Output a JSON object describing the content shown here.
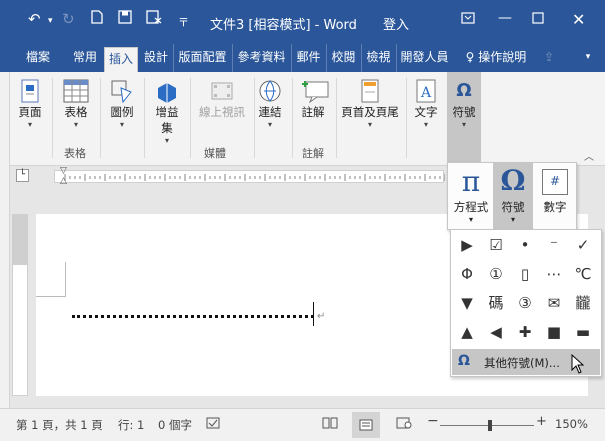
{
  "titlebar": {
    "title": "文件3 [相容模式] - Word",
    "signin": "登入",
    "qa_icons": [
      "undo-icon",
      "redo-icon",
      "new-document-icon",
      "save-icon",
      "save-as-icon",
      "customize-quick-access-icon"
    ],
    "window_controls": [
      "ribbon-display-icon",
      "minimize-icon",
      "maximize-icon",
      "close-icon"
    ]
  },
  "tabs": {
    "items": [
      {
        "label": "檔案"
      },
      {
        "label": "常用"
      },
      {
        "label": "插入"
      },
      {
        "label": "設計"
      },
      {
        "label": "版面配置"
      },
      {
        "label": "參考資料"
      },
      {
        "label": "郵件"
      },
      {
        "label": "校閱"
      },
      {
        "label": "檢視"
      },
      {
        "label": "開發人員"
      }
    ],
    "tell_me": "操作說明",
    "active": "插入"
  },
  "ribbon": {
    "pages_label": "頁面",
    "table_label": "表格",
    "table_group": "表格",
    "illustrations_label": "圖例",
    "addins_label": "增益集",
    "online_video_label": "線上視訊",
    "media_group": "媒體",
    "links_label": "連結",
    "comment_label": "註解",
    "comment_group": "註解",
    "header_footer_label": "頁首及頁尾",
    "text_label": "文字",
    "symbols_label": "符號"
  },
  "symbol_menu": {
    "equation_label": "方程式",
    "symbol_label": "符號",
    "number_label": "數字",
    "more_symbols_label": "其他符號(M)...",
    "symbols": [
      "▶",
      "☑",
      "•",
      "⁻",
      "✓",
      "Φ",
      "①",
      "▯",
      "⋯",
      "℃",
      "▼",
      "碼",
      "③",
      "✉",
      "龖",
      "▲",
      "◀",
      "✚",
      "■",
      "▬"
    ]
  },
  "status": {
    "page": "第 1 頁，共 1 頁",
    "line": "行: 1",
    "words": "0 個字",
    "zoom": "150%"
  },
  "colors": {
    "brand": "#2b579a",
    "ribbon": "#f3f3f3",
    "highlight": "#c6c6c6"
  }
}
